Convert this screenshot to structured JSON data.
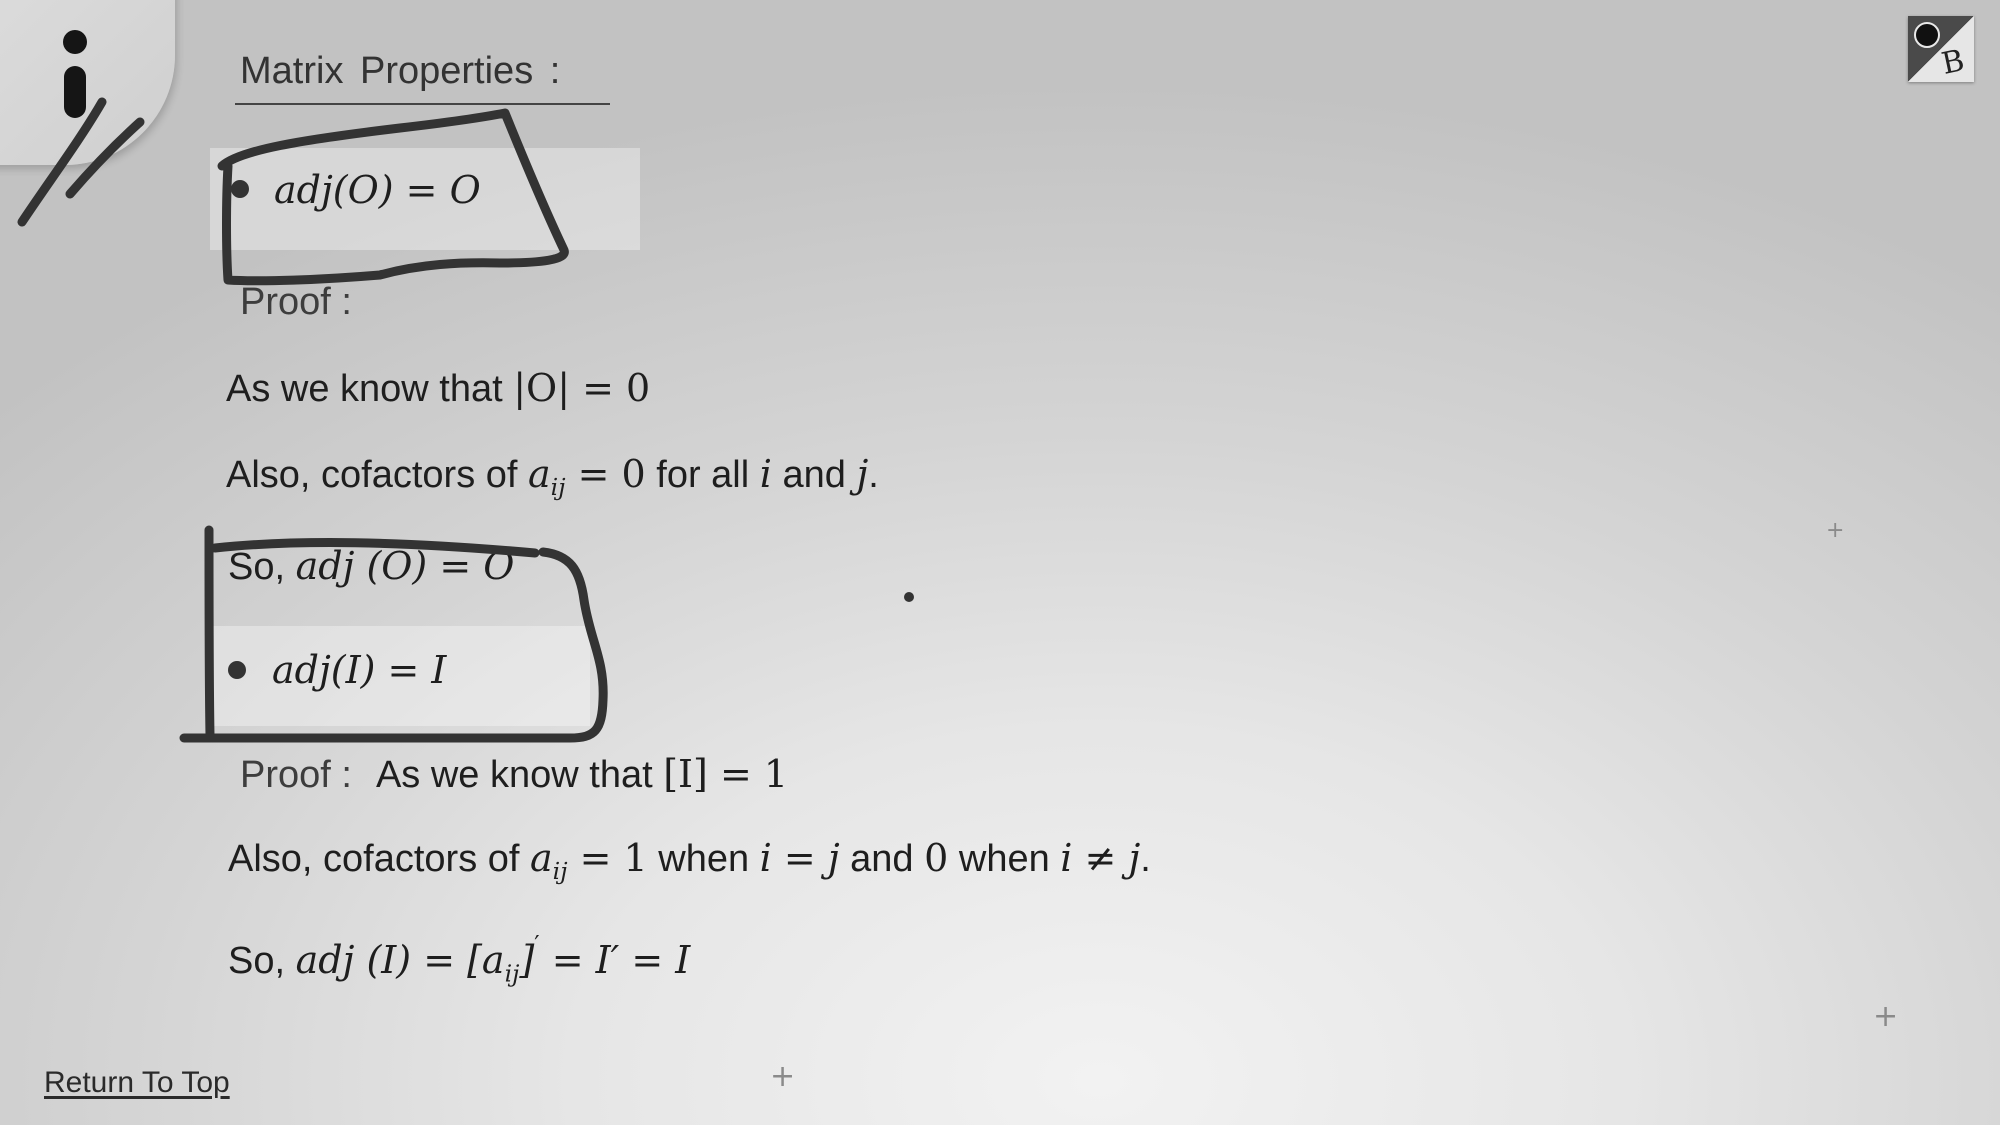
{
  "header": {
    "title": "Matrix  Properties :",
    "badge_letter": "B"
  },
  "property1": {
    "expr": "adj(O) = O",
    "proof_label": "Proof :",
    "line1_text": "As we know that ",
    "line1_math": "|O| = 0",
    "line2_text_a": "Also, cofactors of ",
    "line2_math_a": "a",
    "line2_sub": "ij",
    "line2_math_b": " = 0",
    "line2_text_b": " for all ",
    "line2_math_c": "i",
    "line2_text_c": " and ",
    "line2_math_d": "j",
    "line2_text_d": ".",
    "line3_text": "So, ",
    "line3_math": "adj (O) = O"
  },
  "property2": {
    "expr": "adj(I) = I",
    "proof_label": "Proof :",
    "line1_text": "As we know that ",
    "line1_math": "[I] = 1",
    "line2_text_a": "Also, cofactors of ",
    "line2_math_a": "a",
    "line2_sub": "ij",
    "line2_math_b": " = 1",
    "line2_text_b": " when ",
    "line2_math_c": "i = j",
    "line2_text_c": " and ",
    "line2_math_d": "0",
    "line2_text_d": " when ",
    "line2_math_e": "i ≠ j",
    "line2_text_e": ".",
    "line3_text": "So, ",
    "line3_math_a": "adj (I) = [a",
    "line3_sub": "ij",
    "line3_math_b": "]",
    "line3_sup": "′",
    "line3_math_c": " = I′ = I"
  },
  "footer": {
    "return_link": "Return To Top"
  },
  "decor": {
    "plus_marks": [
      "+",
      "+",
      "+"
    ],
    "icons": [
      "info-icon",
      "app-badge-icon",
      "bullet-icon",
      "plus-icon"
    ],
    "colors": {
      "ink": "#333333",
      "text": "#1e1e1e",
      "background": "#d9d9d9"
    }
  }
}
